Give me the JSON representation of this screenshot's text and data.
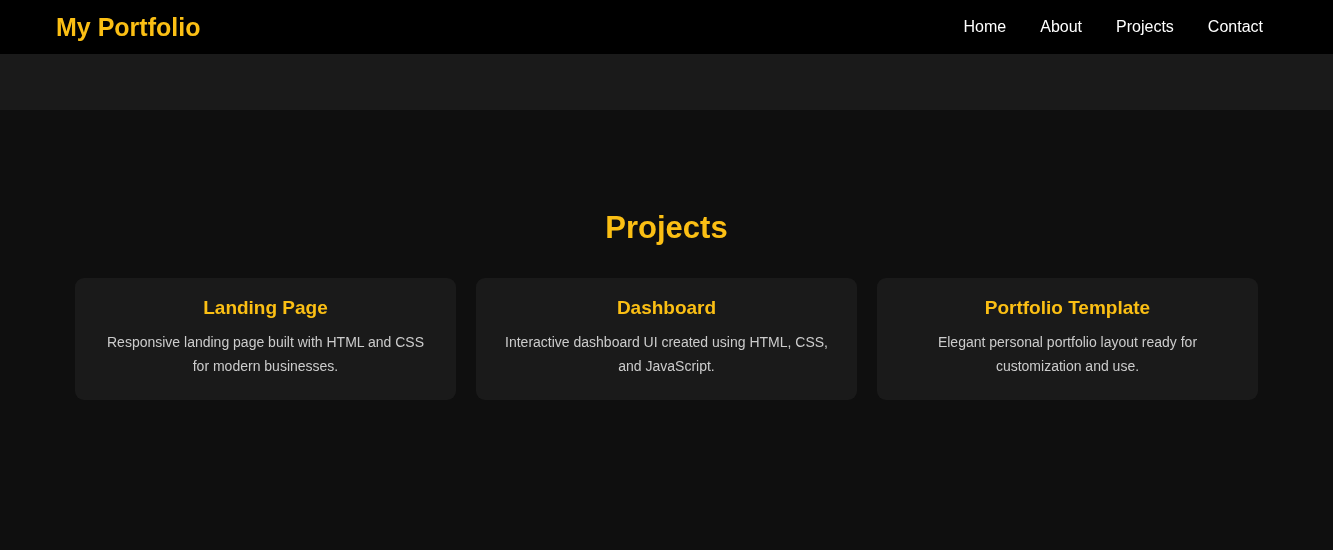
{
  "header": {
    "logo": "My Portfolio",
    "nav": [
      {
        "label": "Home"
      },
      {
        "label": "About"
      },
      {
        "label": "Projects"
      },
      {
        "label": "Contact"
      }
    ]
  },
  "projects": {
    "title": "Projects",
    "cards": [
      {
        "title": "Landing Page",
        "description": "Responsive landing page built with HTML and CSS for modern businesses."
      },
      {
        "title": "Dashboard",
        "description": "Interactive dashboard UI created using HTML, CSS, and JavaScript."
      },
      {
        "title": "Portfolio Template",
        "description": "Elegant personal portfolio layout ready for customization and use."
      }
    ]
  }
}
